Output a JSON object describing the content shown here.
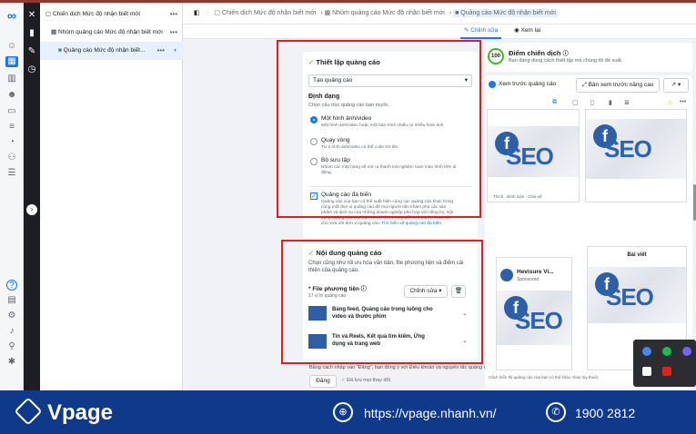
{
  "nav_rail": {
    "icons": [
      "meta-logo-icon",
      "smile-icon",
      "grid-icon",
      "chart-icon",
      "people-icon",
      "card-icon",
      "list-icon",
      "bell-icon",
      "tree-icon",
      "menu-icon"
    ],
    "bottom_icons": [
      "help-icon",
      "note-icon",
      "gear-icon",
      "bell-icon",
      "search-icon",
      "bug-icon"
    ],
    "help_label": "?"
  },
  "tree": {
    "campaign": "Chiến dịch Mức độ nhận biết mới",
    "adset": "Nhóm quảng cáo Mức độ nhận biết mới",
    "ad": "Quảng cáo Mức độ nhận biết...",
    "dots": "•••"
  },
  "breadcrumb": {
    "campaign": "Chiến dịch Mức độ nhận biết mới",
    "adset": "Nhóm quảng cáo Mức độ nhận biết mới",
    "ad": "Quảng cáo Mức độ nhận biết mới"
  },
  "tabs": {
    "edit": "Chỉnh sửa",
    "view": "Xem lại"
  },
  "setup": {
    "title": "Thiết lập quảng cáo",
    "select_value": "Tạo quảng cáo",
    "format_heading": "Định dạng",
    "format_desc": "Chọn cấu trúc quảng cáo bạn muốn.",
    "options": [
      {
        "label": "Một hình ảnh/video",
        "desc": "Một hình ảnh/video hoặc một bản trình chiếu có nhiều hình ảnh"
      },
      {
        "label": "Quay vòng",
        "desc": "Từ 2 hình ảnh/video có thể cuộn trở lên"
      },
      {
        "label": "Bộ sưu tập",
        "desc": "Nhóm các mặt hàng sẽ mở ra thành trải nghiệm toàn màn hình trên di động"
      }
    ],
    "multi_title": "Quảng cáo đa biến",
    "multi_desc": [
      "Quảng cáo của bạn có thể xuất hiện cùng các quảng cáo khác trong",
      "cùng một đơn vị quảng cáo để mọi người tiện khám phá các sản",
      "phẩm và dịch vụ của những doanh nghiệp phù hợp với riêng họ. Nội",
      "dung quảng cáo của bạn có thể được thay đổi kích thước hoặc cắt",
      "cho vừa với đơn vị quảng cáo."
    ],
    "multi_link": "Tìm hiểu về quảng cáo đa biến"
  },
  "content": {
    "title": "Nội dung quảng cáo",
    "desc": [
      "Chọn cũng như tối ưu hóa văn bản, file phương tiện và điểm cải",
      "thiện của quảng cáo."
    ],
    "media_label": "* File phương tiện",
    "media_count": "17 vị trí quảng cáo",
    "edit_button": "Chỉnh sửa",
    "placements": [
      {
        "line1": "Bảng feed, Quảng cáo trong luồng cho",
        "line2": "video và thước phim"
      },
      {
        "line1": "Tin và Reels, Kết quả tìm kiếm, Ứng",
        "line2": "dụng và trang web"
      }
    ]
  },
  "terms": "Bằng cách nhấp vào \"Đăng\", bạn đồng ý với Điều khoản và nguyên tắc quảng cáo của Facebook.",
  "publish_button": "Đăng",
  "saved_status": "Đã lưu mọi thay đổi",
  "score": {
    "value": "100",
    "title": "Điểm chiến dịch",
    "desc": "Bạn đang dùng cách thiết lập mà chúng tôi đề xuất."
  },
  "preview": {
    "toggle_label": "Xem trước quảng cáo",
    "advanced_button": "Bản xem trước nâng cao",
    "seo_letter": "f",
    "seo_text": "SEO",
    "page_name": "Hevisure Vi...",
    "sponsored": "Sponsored",
    "post_label": "Bài viết",
    "like": "Thích",
    "comment": "Bình luận",
    "share": "Chia sẻ",
    "note": "Cách hiển thị quảng cáo của bạn có thể khác nhau tùy thuộc"
  },
  "footer": {
    "brand": "Vpage",
    "url": "https://vpage.nhanh.vn/",
    "phone": "1900 2812"
  },
  "colors": {
    "accent": "#1877f2",
    "highlight_box": "#e02020",
    "footer_bg": "#0f3a8a"
  }
}
